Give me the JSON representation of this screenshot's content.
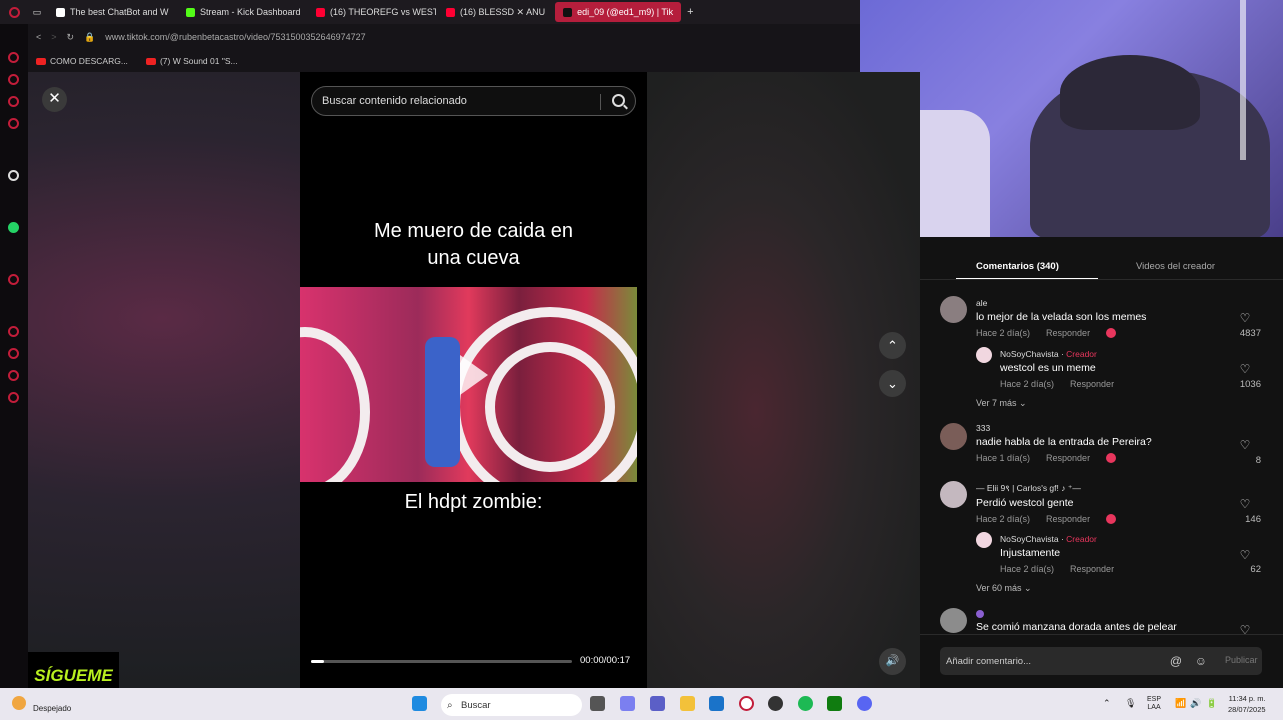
{
  "browser": {
    "tabs": [
      {
        "label": "The best ChatBot and W",
        "color": "#ffffff"
      },
      {
        "label": "Stream - Kick Dashboard",
        "color": "#53fc18"
      },
      {
        "label": "(16) THEOREFG vs WEST",
        "color": "#ff0033"
      },
      {
        "label": "(16) BLESSD ✕ ANU",
        "color": "#ff0033"
      },
      {
        "label": "edi_09 (@ed1_m9) | Tik",
        "color": "#ffffff"
      }
    ],
    "new_tab": "+",
    "url": "www.tiktok.com/@rubenbetacastro/video/7531500352646974727",
    "bookmarks": [
      "COMO DESCARG...",
      "(7) W Sound 01 \"S..."
    ]
  },
  "video": {
    "close_label": "✕",
    "search_placeholder": "Buscar contenido relacionado",
    "caption_top_line1": "Me muero de caida en",
    "caption_top_line2": "una cueva",
    "caption_bottom": "El hdpt zombie:",
    "progress": 0.05,
    "time": "00:00/00:17",
    "up_label": "⌃",
    "down_label": "⌄",
    "volume_label": "🔊"
  },
  "comments": {
    "tab_comments": "Comentarios (340)",
    "tab_videos": "Videos del creador",
    "reply_label": "Responder",
    "items": [
      {
        "user": "ale",
        "text": "lo mejor de la velada son los memes",
        "time": "Hace 2 día(s)",
        "likes": "4837"
      },
      {
        "user": "NoSoyChavista",
        "creator": "Creador",
        "text": "westcol es un meme",
        "time": "Hace 2 día(s)",
        "likes": "1036"
      },
      {
        "more": "Ver 7 más"
      },
      {
        "user": "333",
        "text": "nadie habla de la entrada de Pereira?",
        "time": "Hace 1 día(s)",
        "likes": "8"
      },
      {
        "user": "— Elii 9९ | Carlos's gf! ♪ ⁺—",
        "text": "Perdió westcol gente",
        "time": "Hace 2 día(s)",
        "likes": "146"
      },
      {
        "user": "NoSoyChavista",
        "creator": "Creador",
        "text": "Injustamente",
        "time": "Hace 2 día(s)",
        "likes": "62"
      },
      {
        "more": "Ver 60 más"
      },
      {
        "user": "",
        "text": "Se comió manzana dorada antes de pelear",
        "time": "",
        "likes": ""
      }
    ],
    "input_placeholder": "Añadir comentario...",
    "publish_label": "Publicar"
  },
  "overlay": {
    "follow_text": "SÍGUEME"
  },
  "taskbar": {
    "weather": "Despejado",
    "search_placeholder": "Buscar",
    "lang1": "ESP",
    "lang2": "LAA",
    "clock_time": "11:34 p. m.",
    "clock_date": "28/07/2025",
    "icons": [
      "windows-icon",
      "file-explorer-icon",
      "copilot-icon",
      "teams-icon",
      "folder-icon",
      "vscode-icon",
      "opera-icon",
      "obs-icon",
      "spotify-icon",
      "xbox-icon",
      "discord-icon"
    ]
  }
}
